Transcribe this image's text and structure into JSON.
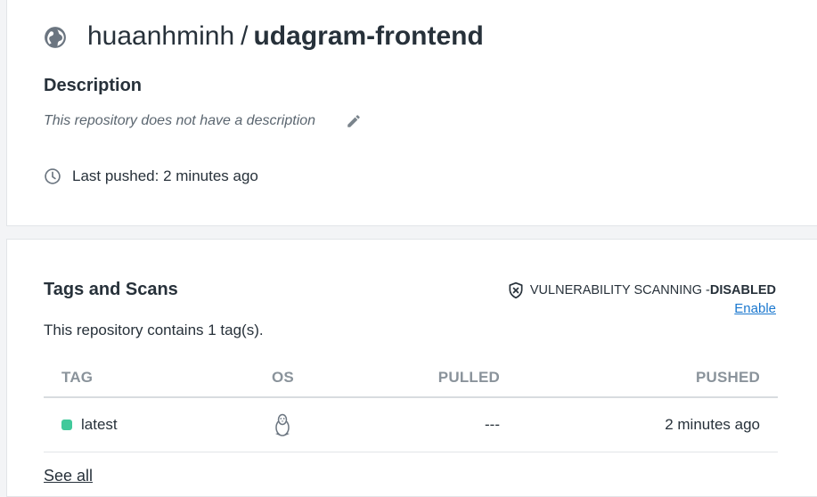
{
  "repo": {
    "owner": "huaanhminh",
    "separator": "/",
    "name": "udagram-frontend",
    "icon": "globe-icon"
  },
  "description": {
    "heading": "Description",
    "text": "This repository does not have a description",
    "edit_icon": "pencil-icon"
  },
  "last_pushed": {
    "text": "Last pushed: 2 minutes ago",
    "icon": "clock-icon"
  },
  "tags": {
    "heading": "Tags and Scans",
    "vulnerability_label": "VULNERABILITY SCANNING - ",
    "vulnerability_status": "DISABLED",
    "enable_link": "Enable",
    "count_text": "This repository contains 1 tag(s).",
    "columns": [
      "TAG",
      "OS",
      "PULLED",
      "PUSHED"
    ],
    "rows": [
      {
        "tag": "latest",
        "status_color": "#41c99b",
        "os_icon": "linux-tux-icon",
        "pulled": "---",
        "pushed": "2 minutes ago"
      }
    ],
    "see_all": "See all"
  },
  "colors": {
    "accent_link": "#1b78cf",
    "text": "#27313a",
    "muted": "#8a939b",
    "tag_dot": "#41c99b"
  }
}
